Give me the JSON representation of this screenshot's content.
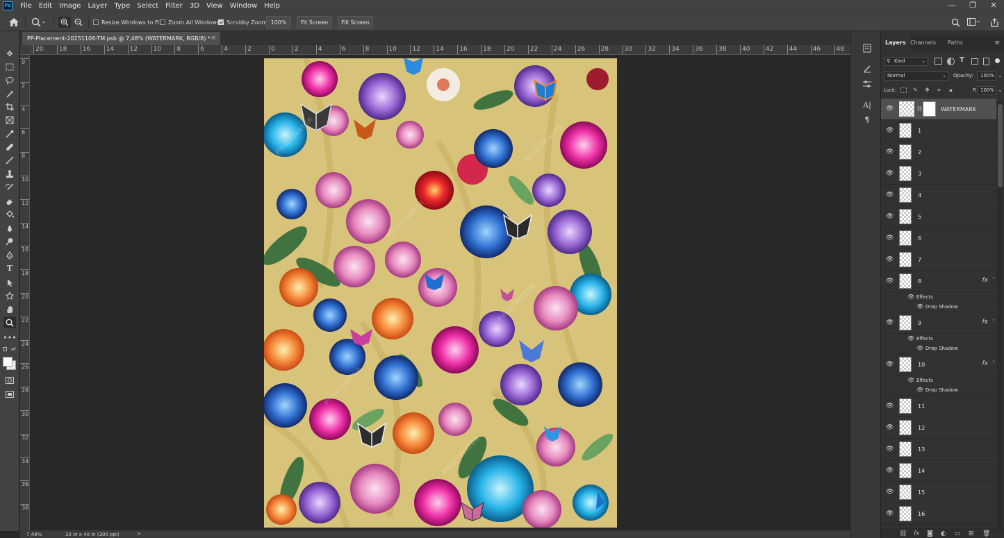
{
  "menubar": {
    "app_icon": "Ps",
    "items": [
      "File",
      "Edit",
      "Image",
      "Layer",
      "Type",
      "Select",
      "Filter",
      "3D",
      "View",
      "Window",
      "Help"
    ]
  },
  "options": {
    "resize_windows_label": "Resize Windows to Fit",
    "resize_windows_checked": false,
    "zoom_all_label": "Zoom All Windows",
    "zoom_all_checked": false,
    "scrubby_label": "Scrubby Zoom",
    "scrubby_checked": true,
    "zoom_value": "100%",
    "fit_screen_label": "Fit Screen",
    "fill_screen_label": "Fill Screen"
  },
  "document": {
    "tab_title": "PP-Placement-20251108-TM.psb @ 7,48% (WATERMARK, RGB/8) *",
    "close_glyph": "×"
  },
  "rulers": {
    "horizontal": [
      "20",
      "18",
      "16",
      "14",
      "12",
      "10",
      "8",
      "6",
      "4",
      "2",
      "0",
      "2",
      "4",
      "6",
      "8",
      "10",
      "12",
      "14",
      "16",
      "18",
      "20",
      "22",
      "24",
      "26",
      "28",
      "30",
      "32",
      "34",
      "36",
      "38",
      "40",
      "42",
      "44",
      "46",
      "48"
    ],
    "vertical": [
      "0",
      "2",
      "4",
      "6",
      "8",
      "10",
      "12",
      "14",
      "16",
      "18",
      "20",
      "22",
      "24",
      "26",
      "28",
      "30",
      "32",
      "34",
      "36",
      "38"
    ]
  },
  "status": {
    "zoom": "7,48%",
    "doc_size": "30 in x 40 in (300 ppi)",
    "arrow": ">"
  },
  "layers_panel": {
    "tabs": [
      "Layers",
      "Channels",
      "Paths"
    ],
    "filter_kind": "Kind",
    "blend_mode": "Normal",
    "opacity_label": "Opacity:",
    "opacity_value": "100%",
    "lock_label": "Lock:",
    "fill_label": "Fill:",
    "fill_value": "100%",
    "effects_label": "Effects",
    "drop_shadow_label": "Drop Shadow",
    "fx_label": "fx",
    "layers": [
      {
        "name": "WATERMARK",
        "selected": true,
        "fx": false
      },
      {
        "name": "1",
        "fx": false
      },
      {
        "name": "2",
        "fx": false
      },
      {
        "name": "3",
        "fx": false
      },
      {
        "name": "4",
        "fx": false
      },
      {
        "name": "5",
        "fx": false
      },
      {
        "name": "6",
        "fx": false
      },
      {
        "name": "7",
        "fx": false
      },
      {
        "name": "8",
        "fx": true
      },
      {
        "name": "9",
        "fx": true
      },
      {
        "name": "10",
        "fx": true
      },
      {
        "name": "11",
        "fx": false
      },
      {
        "name": "12",
        "fx": false
      },
      {
        "name": "13",
        "fx": false
      },
      {
        "name": "14",
        "fx": false
      },
      {
        "name": "15",
        "fx": false
      },
      {
        "name": "16",
        "fx": false
      }
    ],
    "footer_fx": "fx"
  },
  "colors": {
    "canvas_bg": "#d8c37a",
    "panel_bg": "#323232",
    "chrome_bg": "#424242"
  }
}
